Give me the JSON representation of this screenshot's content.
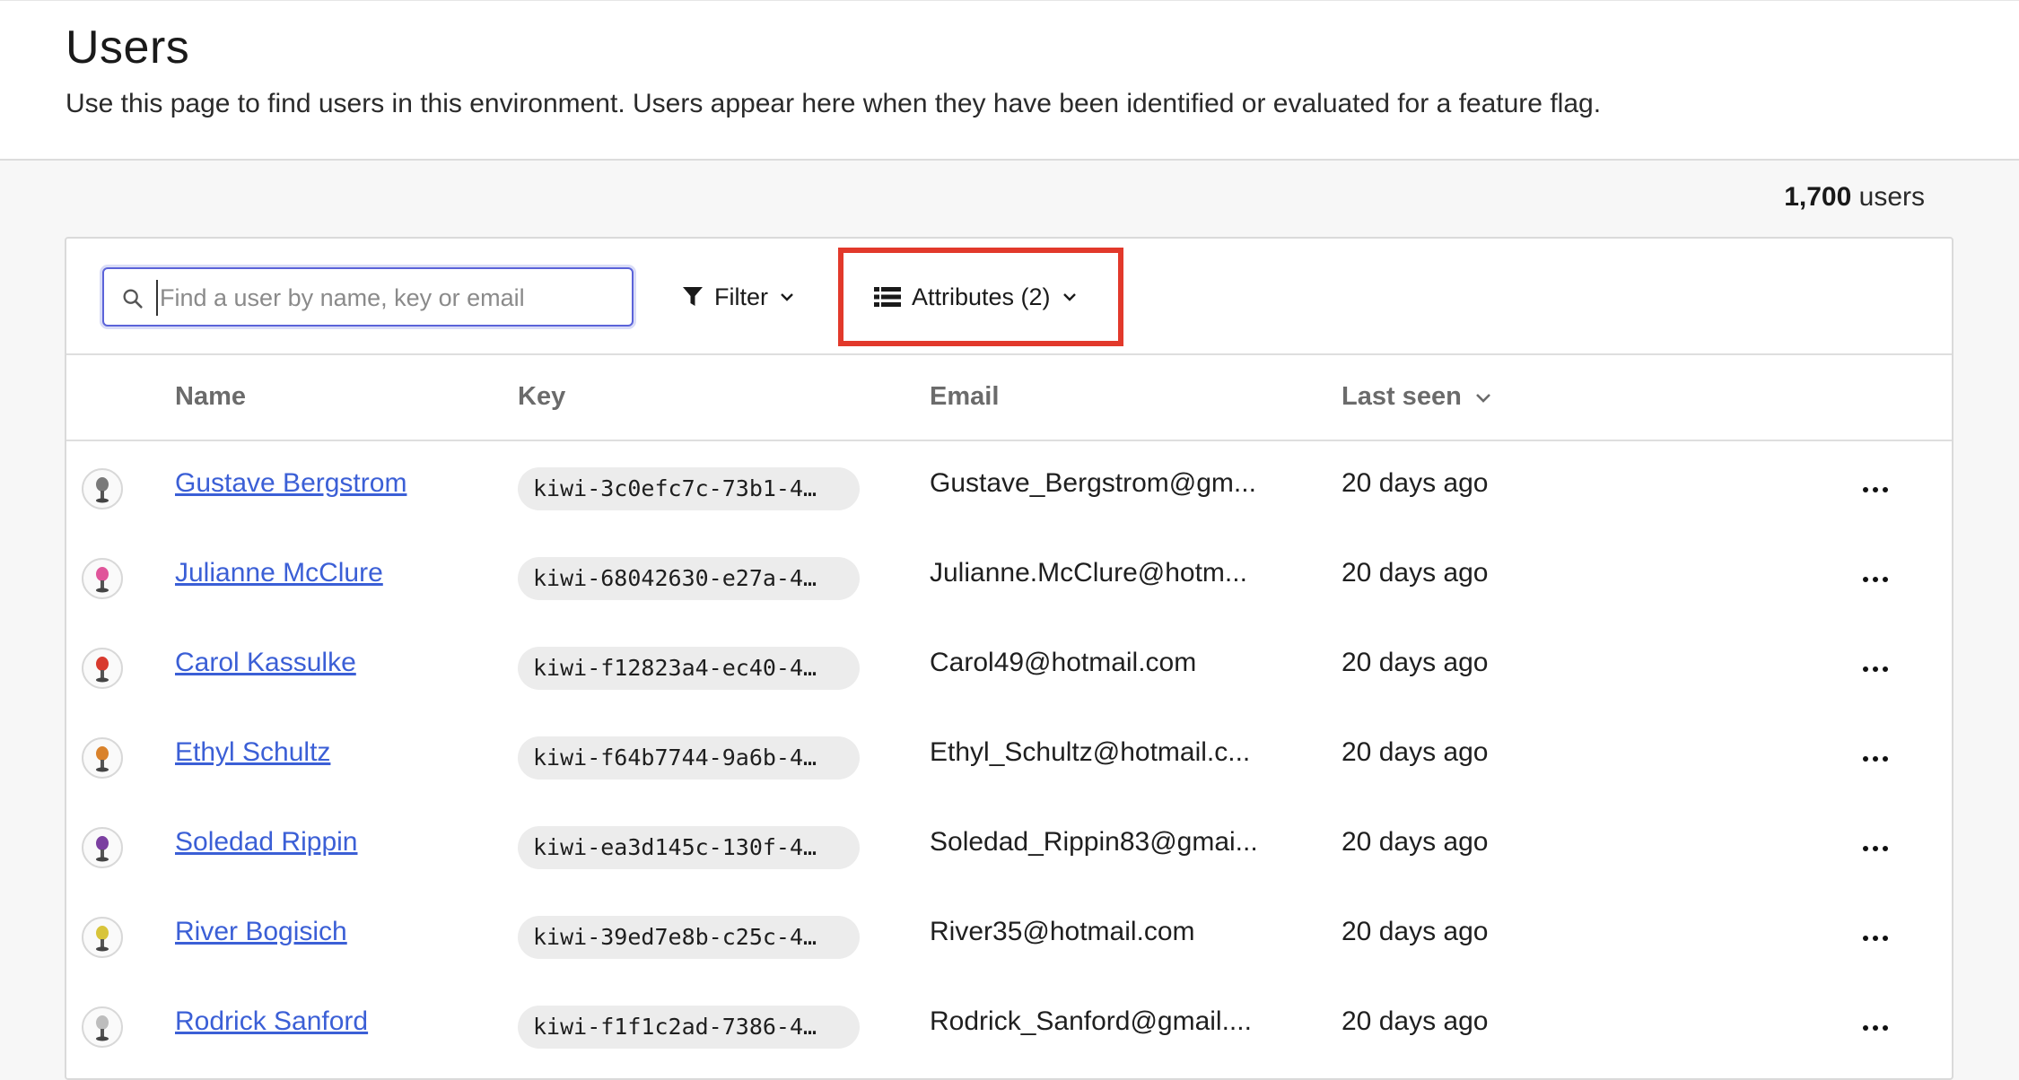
{
  "header": {
    "title": "Users",
    "description": "Use this page to find users in this environment. Users appear here when they have been identified or evaluated for a feature flag."
  },
  "summary": {
    "count": "1,700",
    "count_suffix": "users"
  },
  "toolbar": {
    "search_placeholder": "Find a user by name, key or email",
    "search_value": "",
    "filter_label": "Filter",
    "attributes_label": "Attributes (2)"
  },
  "table": {
    "columns": {
      "name": "Name",
      "key": "Key",
      "email": "Email",
      "last_seen": "Last seen"
    },
    "rows": [
      {
        "name": "Gustave Bergstrom",
        "key": "kiwi-3c0efc7c-73b1-4…",
        "email": "Gustave_Bergstrom@gm...",
        "last_seen": "20 days ago",
        "avatar_color": "#7a7a7a"
      },
      {
        "name": "Julianne McClure",
        "key": "kiwi-68042630-e27a-4…",
        "email": "Julianne.McClure@hotm...",
        "last_seen": "20 days ago",
        "avatar_color": "#e0559a"
      },
      {
        "name": "Carol Kassulke",
        "key": "kiwi-f12823a4-ec40-4…",
        "email": "Carol49@hotmail.com",
        "last_seen": "20 days ago",
        "avatar_color": "#d83a2e"
      },
      {
        "name": "Ethyl Schultz",
        "key": "kiwi-f64b7744-9a6b-4…",
        "email": "Ethyl_Schultz@hotmail.c...",
        "last_seen": "20 days ago",
        "avatar_color": "#d9822b"
      },
      {
        "name": "Soledad Rippin",
        "key": "kiwi-ea3d145c-130f-4…",
        "email": "Soledad_Rippin83@gmai...",
        "last_seen": "20 days ago",
        "avatar_color": "#7b3fa0"
      },
      {
        "name": "River Bogisich",
        "key": "kiwi-39ed7e8b-c25c-4…",
        "email": "River35@hotmail.com",
        "last_seen": "20 days ago",
        "avatar_color": "#d8c43a"
      },
      {
        "name": "Rodrick Sanford",
        "key": "kiwi-f1f1c2ad-7386-4…",
        "email": "Rodrick_Sanford@gmail....",
        "last_seen": "20 days ago",
        "avatar_color": "#bdbdbd"
      }
    ]
  },
  "colors": {
    "accent": "#5b63d9",
    "link": "#3b5fd6",
    "highlight": "#e2392b"
  }
}
